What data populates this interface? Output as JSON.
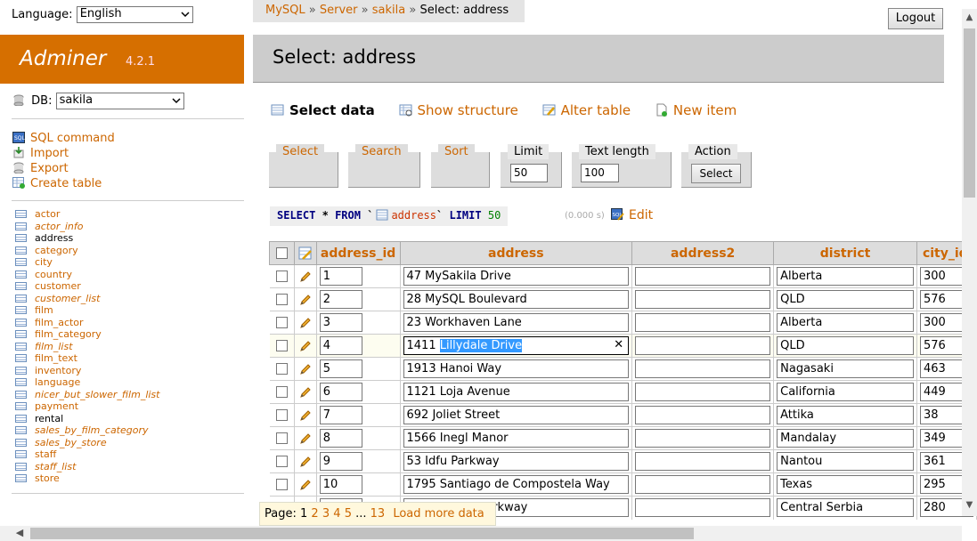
{
  "language": {
    "label": "Language:",
    "value": "English"
  },
  "brand": {
    "name": "Adminer",
    "version": "4.2.1",
    "color": "#d66f00"
  },
  "db": {
    "label": "DB:",
    "value": "sakila"
  },
  "commands": [
    "SQL command",
    "Import",
    "Export",
    "Create table"
  ],
  "tables": [
    {
      "name": "actor",
      "view": false
    },
    {
      "name": "actor_info",
      "view": true
    },
    {
      "name": "address",
      "view": false,
      "current": true
    },
    {
      "name": "category",
      "view": false
    },
    {
      "name": "city",
      "view": false
    },
    {
      "name": "country",
      "view": false
    },
    {
      "name": "customer",
      "view": false
    },
    {
      "name": "customer_list",
      "view": true
    },
    {
      "name": "film",
      "view": false
    },
    {
      "name": "film_actor",
      "view": false
    },
    {
      "name": "film_category",
      "view": false
    },
    {
      "name": "film_list",
      "view": true
    },
    {
      "name": "film_text",
      "view": false
    },
    {
      "name": "inventory",
      "view": false
    },
    {
      "name": "language",
      "view": false
    },
    {
      "name": "nicer_but_slower_film_list",
      "view": true
    },
    {
      "name": "payment",
      "view": false
    },
    {
      "name": "rental",
      "view": false,
      "current_black": true
    },
    {
      "name": "sales_by_film_category",
      "view": true
    },
    {
      "name": "sales_by_store",
      "view": true
    },
    {
      "name": "staff",
      "view": false
    },
    {
      "name": "staff_list",
      "view": true
    },
    {
      "name": "store",
      "view": false
    }
  ],
  "breadcrumb": {
    "mysql": "MySQL",
    "server": "Server",
    "db": "sakila",
    "current": "Select: address",
    "sep": "»"
  },
  "logout": "Logout",
  "page_title": "Select: address",
  "links": {
    "select_data": "Select data",
    "show_structure": "Show structure",
    "alter_table": "Alter table",
    "new_item": "New item"
  },
  "form": {
    "select": "Select",
    "search": "Search",
    "sort": "Sort",
    "limit_label": "Limit",
    "limit_value": "50",
    "textlen_label": "Text length",
    "textlen_value": "100",
    "action_label": "Action",
    "action_button": "Select"
  },
  "query": {
    "select": "SELECT",
    "star": "*",
    "from": "FROM",
    "tick": "`",
    "table": "address",
    "limit": "LIMIT",
    "limit_value": "50",
    "time": "(0.000 s)",
    "edit": "Edit"
  },
  "columns": [
    "address_id",
    "address",
    "address2",
    "district",
    "city_id"
  ],
  "rows": [
    {
      "id": "1",
      "address": "47 MySakila Drive",
      "address2": "",
      "district": "Alberta",
      "city": "300"
    },
    {
      "id": "2",
      "address": "28 MySQL Boulevard",
      "address2": "",
      "district": "QLD",
      "city": "576"
    },
    {
      "id": "3",
      "address": "23 Workhaven Lane",
      "address2": "",
      "district": "Alberta",
      "city": "300"
    },
    {
      "id": "4",
      "address_pre": "1411 ",
      "address_sel": "Lillydale Drive",
      "address2": "",
      "district": "QLD",
      "city": "576",
      "editing": true
    },
    {
      "id": "5",
      "address": "1913 Hanoi Way",
      "address2": "",
      "district": "Nagasaki",
      "city": "463"
    },
    {
      "id": "6",
      "address": "1121 Loja Avenue",
      "address2": "",
      "district": "California",
      "city": "449"
    },
    {
      "id": "7",
      "address": "692 Joliet Street",
      "address2": "",
      "district": "Attika",
      "city": "38"
    },
    {
      "id": "8",
      "address": "1566 Inegl Manor",
      "address2": "",
      "district": "Mandalay",
      "city": "349"
    },
    {
      "id": "9",
      "address": "53 Idfu Parkway",
      "address2": "",
      "district": "Nantou",
      "city": "361"
    },
    {
      "id": "10",
      "address": "1795 Santiago de Compostela Way",
      "address2": "",
      "district": "Texas",
      "city": "295"
    },
    {
      "id": "",
      "address": "Compostela Parkway",
      "address2": "",
      "district": "Central Serbia",
      "city": "280"
    }
  ],
  "pager": {
    "label": "Page:",
    "current": "1",
    "pages": [
      "2",
      "3",
      "4",
      "5"
    ],
    "ellipsis": "...",
    "last": "13",
    "load_more": "Load more data"
  }
}
